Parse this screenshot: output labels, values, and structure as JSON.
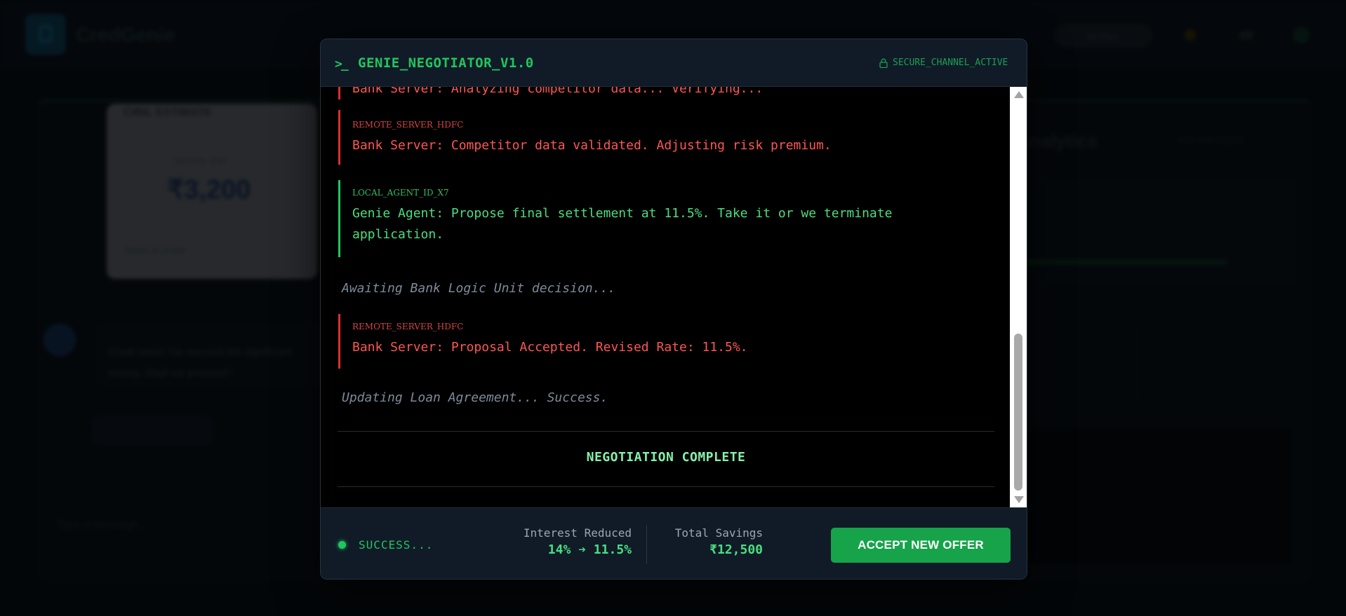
{
  "background": {
    "brand": "CredGenie",
    "header_pill": "Verified",
    "card_title": "CIBIL ESTIMATE",
    "card_sub": "Monthly EMI",
    "card_value": "₹3,200",
    "card_foot": "Based on profile",
    "chat_message": "Great news! I've secured the significant money. Shall we proceed?",
    "input_placeholder": "Type a message...",
    "right_title": "Analytics",
    "right_link": "View Full Report"
  },
  "modal": {
    "prompt_icon": ">_",
    "title": "GENIE_NEGOTIATOR_V1.0",
    "channel_status": "SECURE_CHANNEL_ACTIVE",
    "log": {
      "entries": [
        {
          "type": "bank",
          "sender": "",
          "message": "Bank Server: Analyzing competitor data... Verifying..."
        },
        {
          "type": "bank",
          "sender": "REMOTE_SERVER_HDFC",
          "message": "Bank Server: Competitor data validated. Adjusting risk premium."
        },
        {
          "type": "agent",
          "sender": "LOCAL_AGENT_ID_X7",
          "message": "Genie Agent: Propose final settlement at 11.5%. Take it or we terminate",
          "message_line2": "application."
        },
        {
          "type": "system",
          "message": "Awaiting Bank Logic Unit decision..."
        },
        {
          "type": "bank",
          "sender": "REMOTE_SERVER_HDFC",
          "message": "Bank Server: Proposal Accepted. Revised Rate: 11.5%."
        },
        {
          "type": "system",
          "message": "Updating Loan Agreement... Success."
        }
      ],
      "complete_label": "NEGOTIATION COMPLETE"
    },
    "footer": {
      "status": "SUCCESS...",
      "interest_label": "Interest Reduced",
      "interest_value": "14% ➔ 11.5%",
      "savings_label": "Total Savings",
      "savings_value": "₹12,500",
      "accept_label": "ACCEPT NEW OFFER"
    },
    "colors": {
      "accent_green": "#22c55e",
      "bank_red": "#ff5555",
      "button_green": "#16a34a"
    }
  }
}
